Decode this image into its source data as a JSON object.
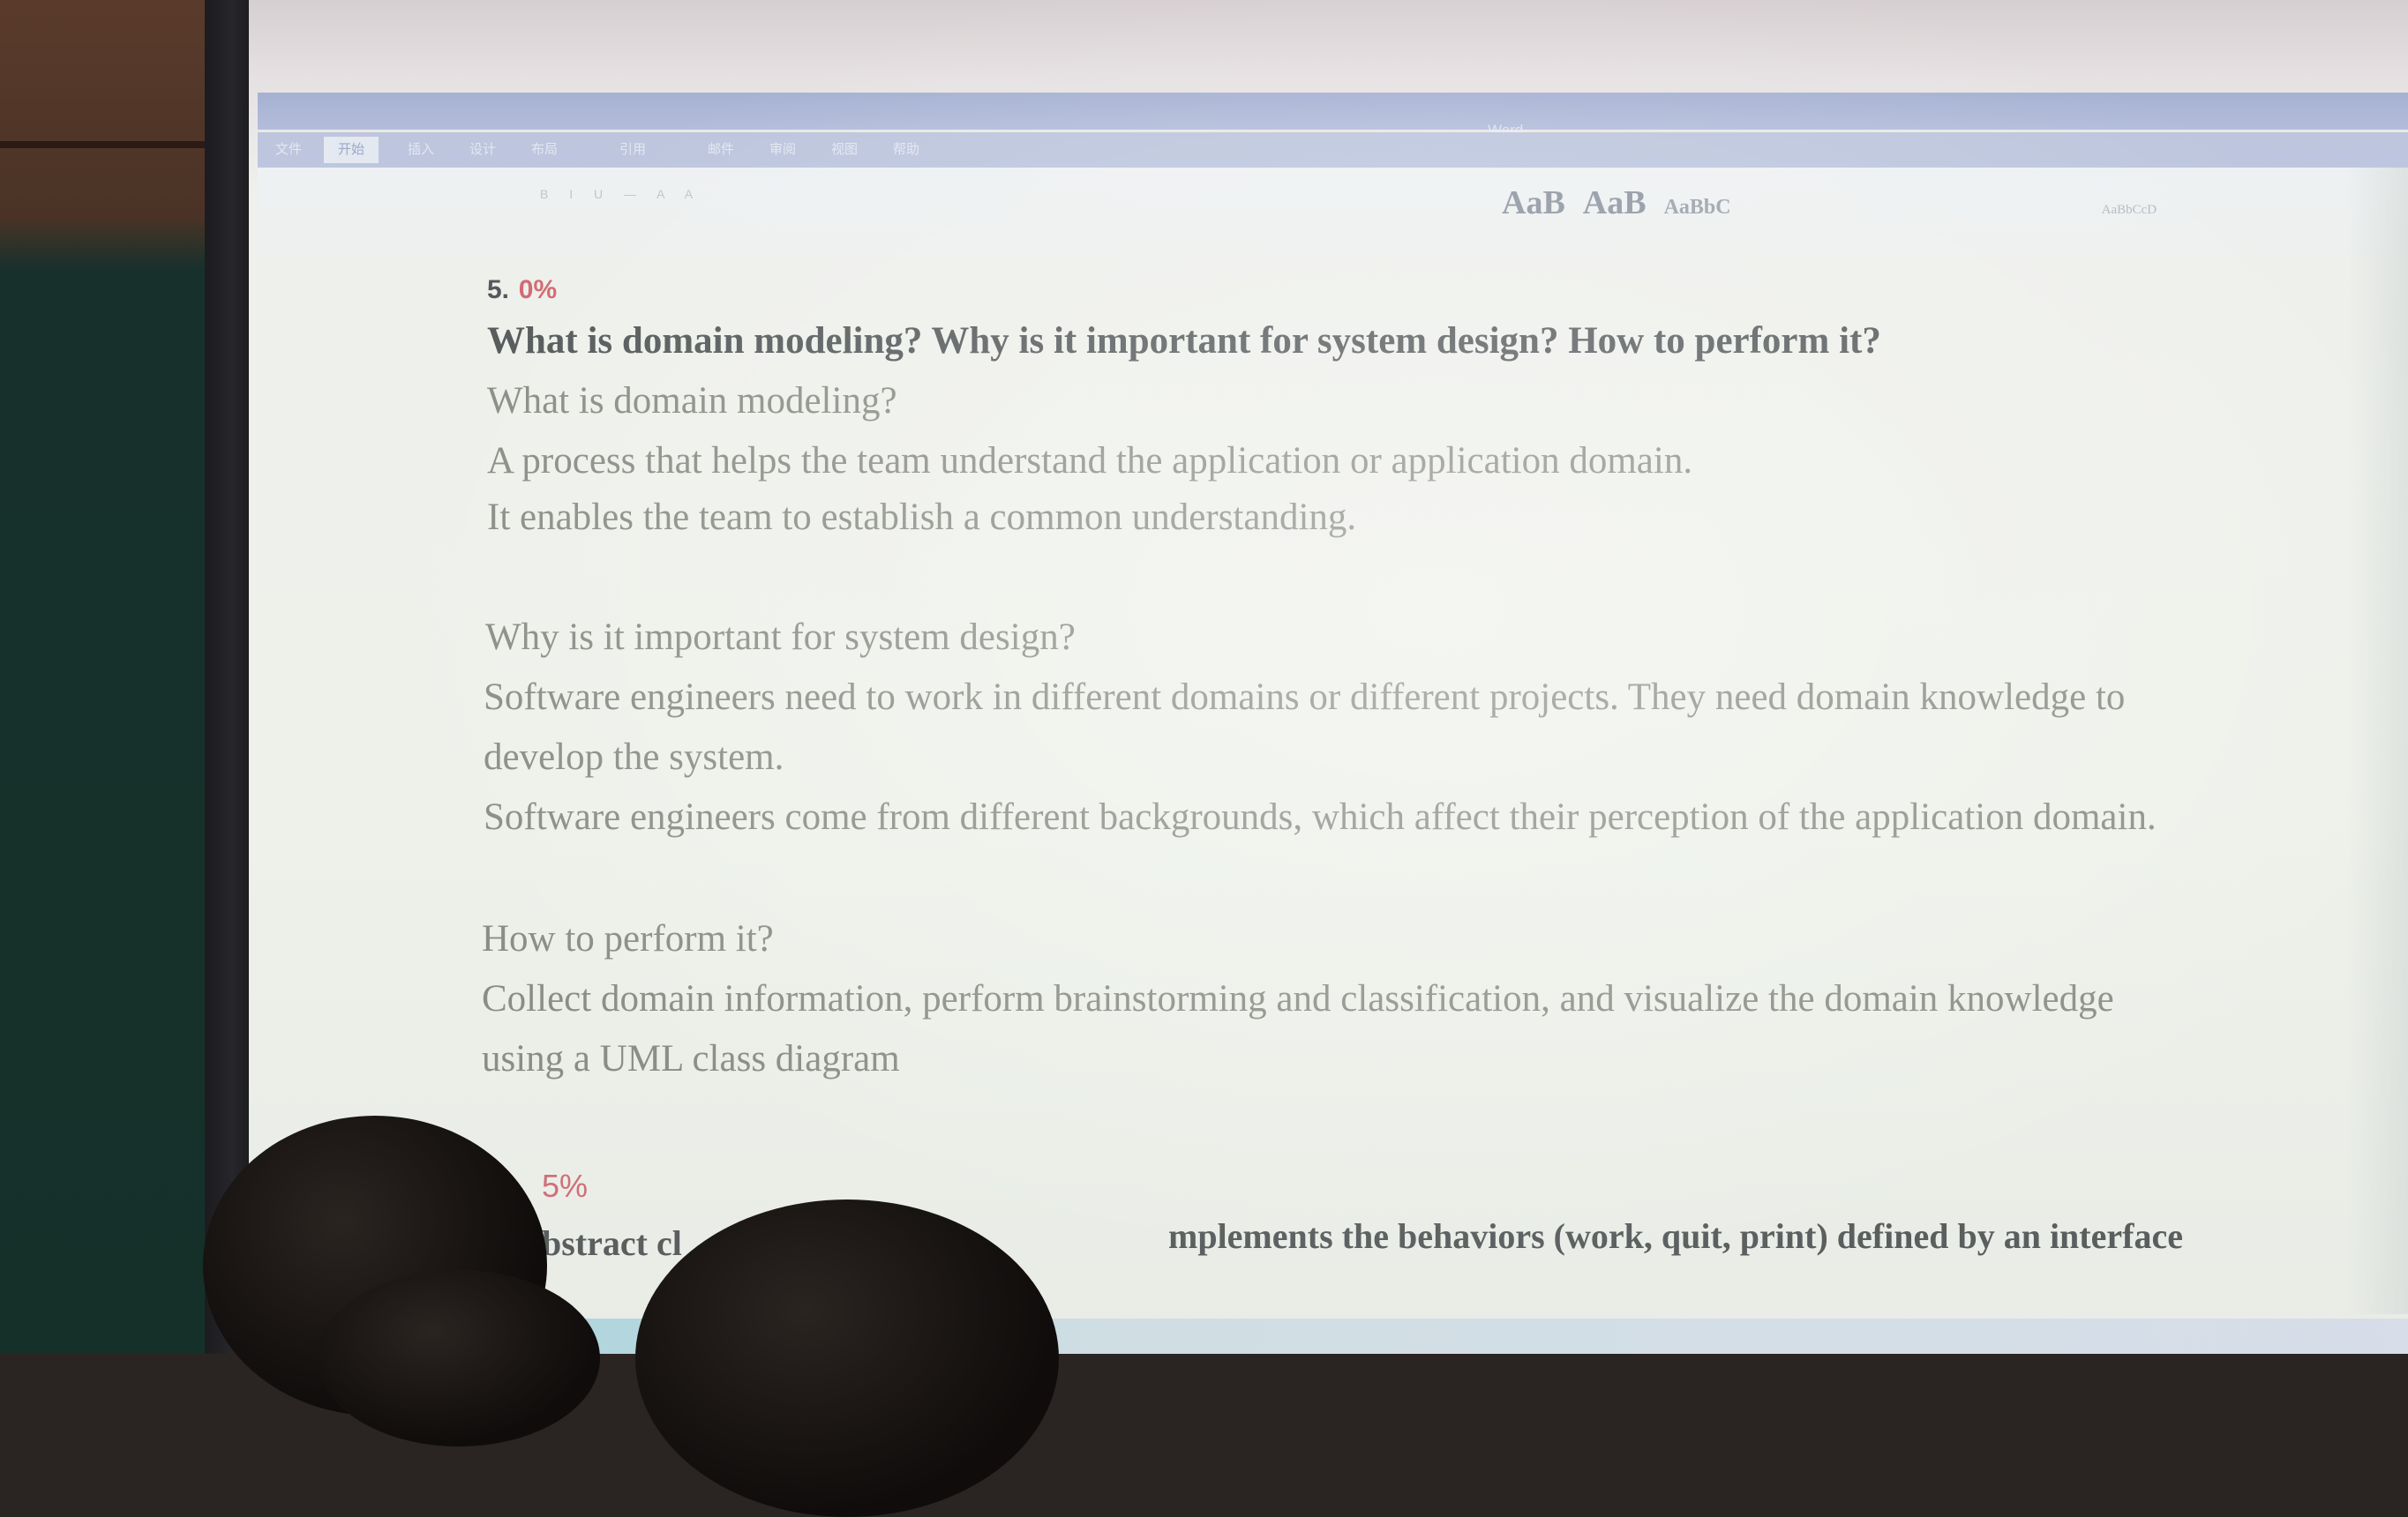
{
  "app": {
    "title_bar": "……Word",
    "tabs": [
      "文件",
      "开始",
      "插入",
      "设计",
      "布局",
      "引用",
      "邮件",
      "审阅",
      "视图",
      "帮助"
    ],
    "style_gallery": {
      "large_1": "AaB",
      "large_2": "AaB",
      "medium": "AaBbC",
      "small": "AaBbCcD"
    }
  },
  "document": {
    "section_number": "5.",
    "section_percent": "0%",
    "question": "What is domain modeling? Why is it important for system design? How to perform it?",
    "part1_heading": "What is domain modeling?",
    "part1_lines": [
      "A process that helps the team understand the application or application domain.",
      "It enables the team to establish a common understanding."
    ],
    "part2_heading": "Why is it important for system design?",
    "part2_lines": [
      "Software engineers need to work in different domains or different projects. They need domain knowledge to",
      "develop the system.",
      "Software engineers come from different backgrounds, which affect their perception of the application domain."
    ],
    "part3_heading": "How to perform it?",
    "part3_lines": [
      "Collect domain information, perform brainstorming and classification, and visualize the domain knowledge",
      "using a UML class diagram"
    ],
    "next_section_percent": "5%",
    "next_question_start": "bstract cl",
    "next_question_end": "mplements the behaviors (work, quit, print) defined by an interface"
  }
}
